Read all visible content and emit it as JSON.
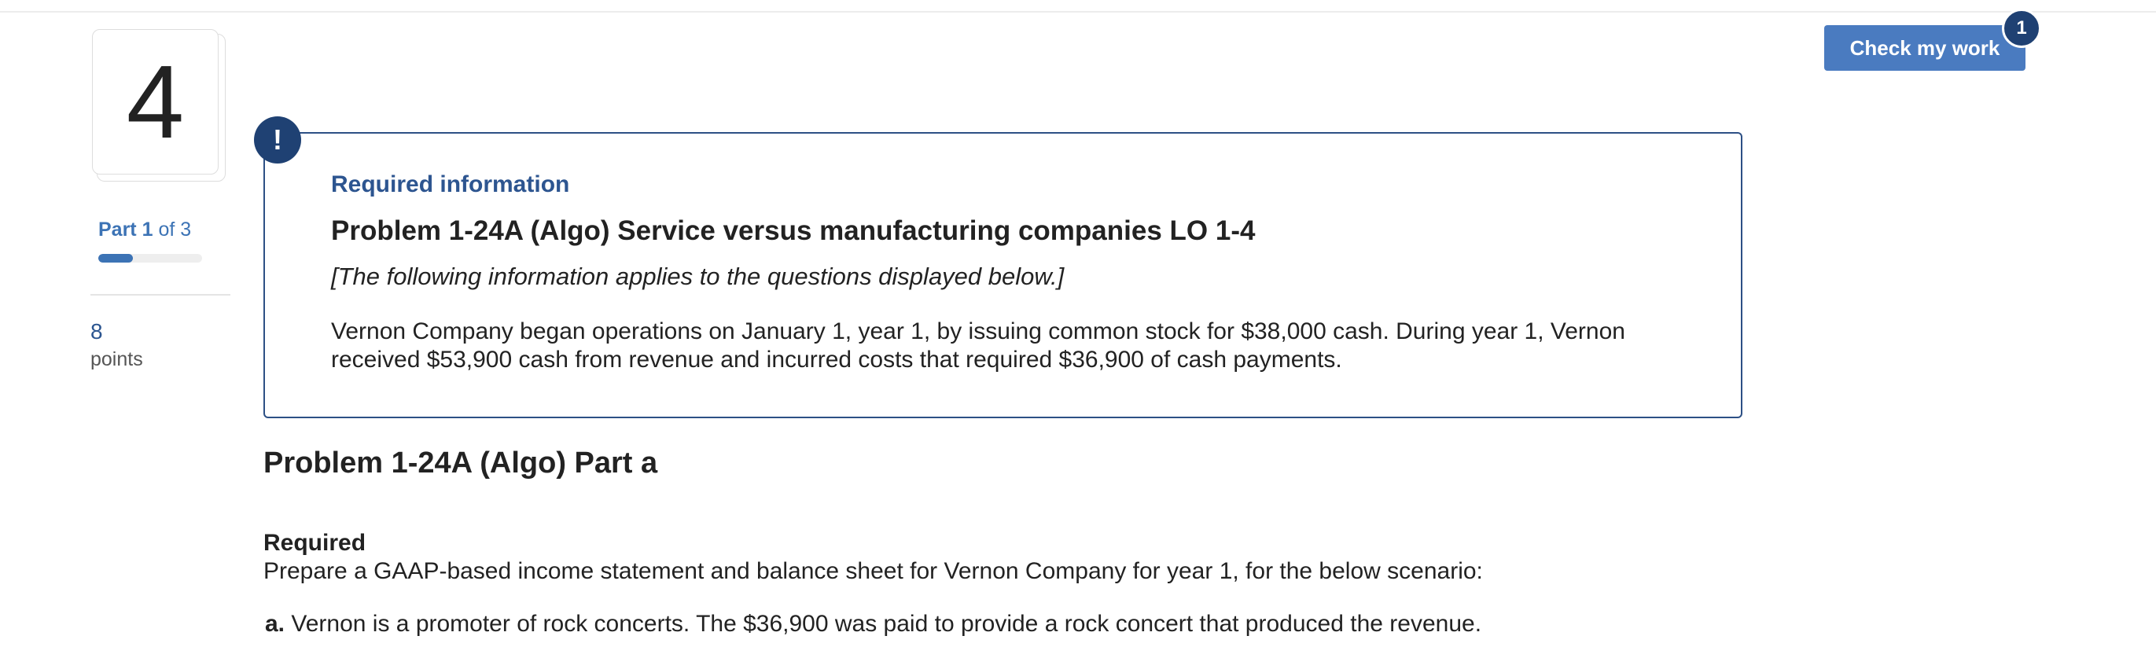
{
  "question": {
    "number": "4",
    "part_prefix": "Part",
    "part_current": "1",
    "part_of": "of 3",
    "part_progress": 0.33,
    "points_value": "8",
    "points_label": "points"
  },
  "header": {
    "check_button_label": "Check my work",
    "check_badge_count": "1"
  },
  "info_box": {
    "alert_icon": "!",
    "heading": "Required information",
    "title": "Problem 1-24A (Algo) Service versus manufacturing companies LO 1-4",
    "note": "[The following information applies to the questions displayed below.]",
    "body": "Vernon Company began operations on January 1, year 1, by issuing common stock for $38,000 cash. During year 1, Vernon received $53,900 cash from revenue and incurred costs that required $36,900 of cash payments."
  },
  "part": {
    "title": "Problem 1-24A (Algo) Part a",
    "required_label": "Required",
    "required_text": "Prepare a GAAP-based income statement and balance sheet for Vernon Company for year 1, for the below scenario:",
    "scenario_label": "a.",
    "scenario_text": "Vernon is a promoter of rock concerts. The $36,900 was paid to provide a rock concert that produced the revenue."
  },
  "colors": {
    "accent": "#3c73b5",
    "dark_blue": "#1f4173",
    "button": "#4a7bc0",
    "box_border": "#2d5085"
  }
}
